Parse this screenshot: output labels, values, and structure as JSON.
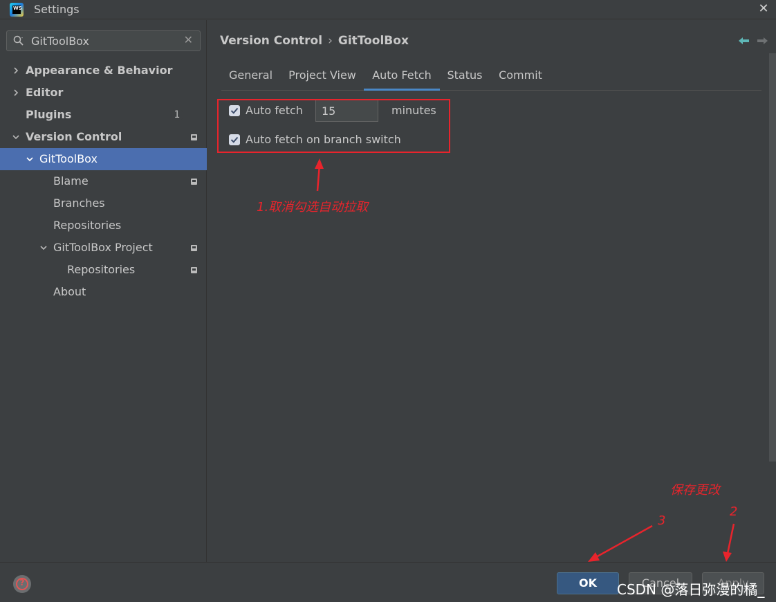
{
  "window": {
    "title": "Settings",
    "app_icon_label": "WS"
  },
  "sidebar": {
    "search": {
      "value": "GitToolBox"
    },
    "items": [
      {
        "label": "Appearance & Behavior"
      },
      {
        "label": "Editor"
      },
      {
        "label": "Plugins",
        "badge": "1"
      },
      {
        "label": "Version Control"
      },
      {
        "label": "GitToolBox"
      },
      {
        "label": "Blame"
      },
      {
        "label": "Branches"
      },
      {
        "label": "Repositories"
      },
      {
        "label": "GitToolBox Project"
      },
      {
        "label": "Repositories"
      },
      {
        "label": "About"
      }
    ]
  },
  "main": {
    "breadcrumb": {
      "parent": "Version Control",
      "separator": "›",
      "current": "GitToolBox"
    },
    "tabs": [
      {
        "label": "General"
      },
      {
        "label": "Project View"
      },
      {
        "label": "Auto Fetch",
        "active": true
      },
      {
        "label": "Status"
      },
      {
        "label": "Commit"
      }
    ],
    "auto_fetch": {
      "label": "Auto fetch",
      "checked": true,
      "interval_value": "15",
      "unit": "minutes"
    },
    "auto_fetch_branch": {
      "label": "Auto fetch on branch switch",
      "checked": true
    }
  },
  "annotations": {
    "step1": "1.取消勾选自动拉取",
    "save": "保存更改",
    "step2": "2",
    "step3": "3",
    "color": "#e8242c"
  },
  "footer": {
    "ok_label": "OK",
    "cancel_label": "Cancel",
    "apply_label": "Apply"
  },
  "watermark": "CSDN @落日弥漫的橘_",
  "colors": {
    "background": "#3c3f41",
    "selection": "#4b6eaf",
    "tab_underline": "#4a88c7",
    "ok_button": "#365880"
  }
}
